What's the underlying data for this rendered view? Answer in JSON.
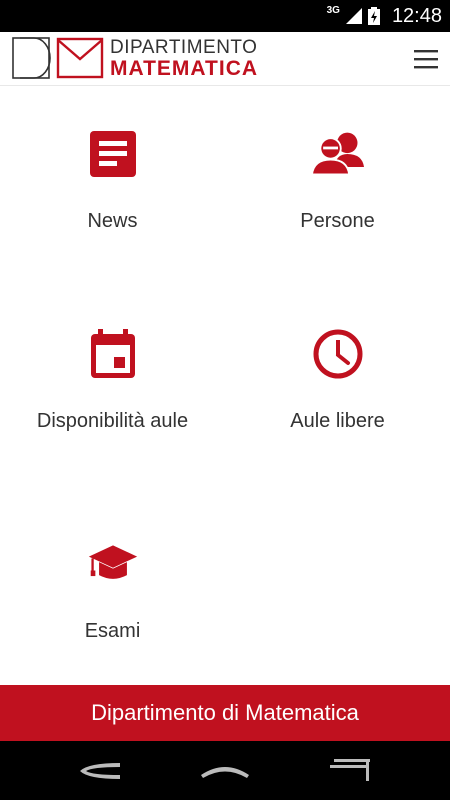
{
  "status_bar": {
    "network_type": "3G",
    "time": "12:48",
    "icons": [
      "signal-icon",
      "battery-icon"
    ]
  },
  "app_bar": {
    "logo_line1": "DIPARTIMENTO",
    "logo_line2": "MATEMATICA",
    "menu_icon": "hamburger-menu-icon"
  },
  "tiles": [
    {
      "label": "News",
      "icon": "news-icon"
    },
    {
      "label": "Persone",
      "icon": "people-icon"
    },
    {
      "label": "Disponibilità aule",
      "icon": "calendar-icon"
    },
    {
      "label": "Aule libere",
      "icon": "clock-icon"
    },
    {
      "label": "Esami",
      "icon": "graduation-cap-icon"
    }
  ],
  "footer": {
    "title": "Dipartimento di Matematica"
  },
  "nav_bar": {
    "buttons": [
      "back-icon",
      "home-icon",
      "recent-apps-icon"
    ]
  },
  "colors": {
    "accent": "#c0111f",
    "text": "#333333",
    "status_bar": "#000000"
  }
}
